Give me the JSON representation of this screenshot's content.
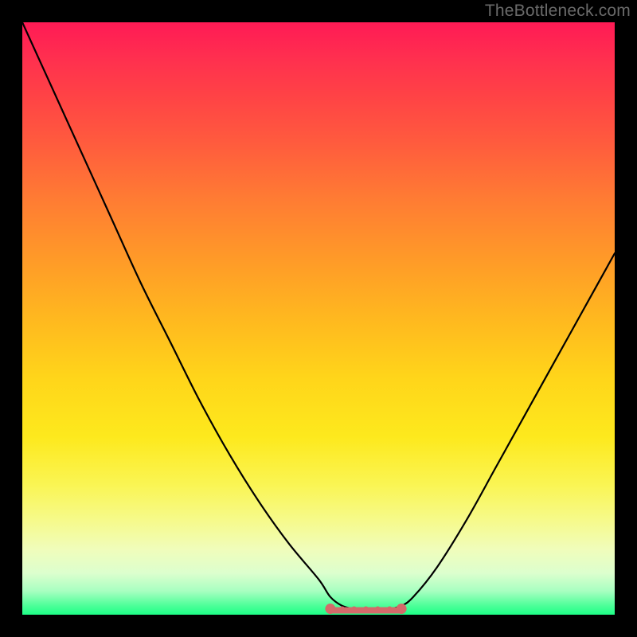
{
  "watermark": "TheBottleneck.com",
  "colors": {
    "frame": "#000000",
    "curve": "#000000",
    "marker": "#d46a6a",
    "gradient_top": "#ff1a55",
    "gradient_bottom": "#1eff87"
  },
  "chart_data": {
    "type": "line",
    "title": "",
    "xlabel": "",
    "ylabel": "",
    "xlim": [
      0,
      100
    ],
    "ylim": [
      0,
      100
    ],
    "x": [
      0,
      5,
      10,
      15,
      20,
      25,
      30,
      35,
      40,
      45,
      50,
      52,
      54,
      56,
      58,
      60,
      62,
      64,
      66,
      70,
      75,
      80,
      85,
      90,
      95,
      100
    ],
    "values": [
      100,
      89,
      78,
      67,
      56,
      46,
      36,
      27,
      19,
      12,
      6,
      3,
      1.5,
      1,
      1,
      1,
      1,
      1.5,
      3,
      8,
      16,
      25,
      34,
      43,
      52,
      61
    ],
    "series": [
      {
        "name": "bottleneck-curve",
        "x": [
          0,
          5,
          10,
          15,
          20,
          25,
          30,
          35,
          40,
          45,
          50,
          52,
          54,
          56,
          58,
          60,
          62,
          64,
          66,
          70,
          75,
          80,
          85,
          90,
          95,
          100
        ],
        "values": [
          100,
          89,
          78,
          67,
          56,
          46,
          36,
          27,
          19,
          12,
          6,
          3,
          1.5,
          1,
          1,
          1,
          1,
          1.5,
          3,
          8,
          16,
          25,
          34,
          43,
          52,
          61
        ]
      }
    ],
    "highlight_range": {
      "x_start": 52,
      "x_end": 64,
      "y": 1,
      "desc": "trough-markers"
    }
  }
}
